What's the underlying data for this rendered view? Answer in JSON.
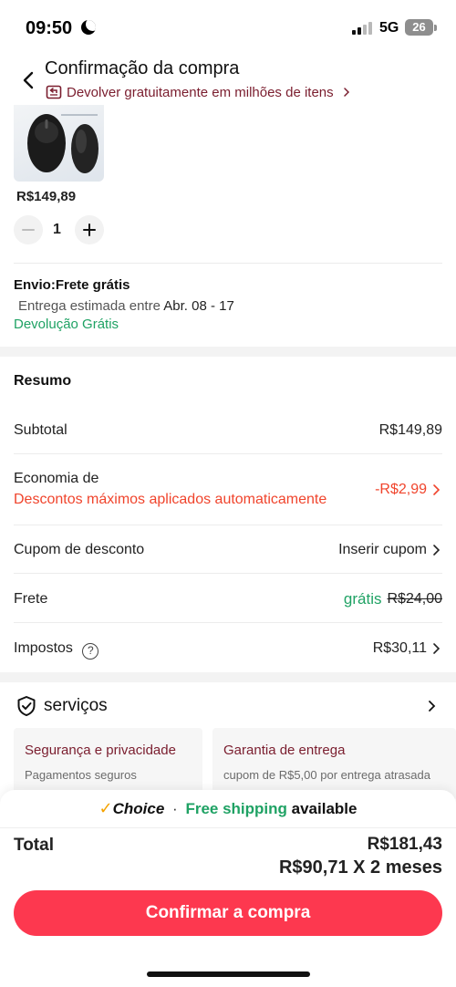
{
  "status_bar": {
    "time": "09:50",
    "network": "5G",
    "battery": "26"
  },
  "header": {
    "title": "Confirmação da compra",
    "return_banner": "Devolver gratuitamente em milhões de itens"
  },
  "product": {
    "price": "R$149,89",
    "quantity": "1"
  },
  "shipping": {
    "title": "Envio:Frete grátis",
    "delivery_prefix": "Entrega estimada entre",
    "delivery_dates": "Abr. 08 - 17",
    "free_return": "Devolução Grátis"
  },
  "summary": {
    "title": "Resumo",
    "subtotal_label": "Subtotal",
    "subtotal_value": "R$149,89",
    "savings_label": "Economia de",
    "savings_desc": "Descontos máximos aplicados automaticamente",
    "savings_value": "-R$2,99",
    "coupon_label": "Cupom de desconto",
    "coupon_value": "Inserir cupom",
    "shipping_label": "Frete",
    "shipping_free": "grátis",
    "shipping_old": "R$24,00",
    "taxes_label": "Impostos",
    "taxes_value": "R$30,11"
  },
  "services": {
    "title": "serviços",
    "cards": [
      {
        "title": "Segurança e privacidade",
        "subtitle": "Pagamentos seguros"
      },
      {
        "title": "Garantia de entrega",
        "subtitle": "cupom de R$5,00 por entrega atrasada"
      }
    ]
  },
  "footer": {
    "choice_mark": "✓",
    "choice_label": "Choice",
    "choice_sep": "·",
    "free_shipping": "Free shipping",
    "available": "available",
    "total_label": "Total",
    "total_value": "R$181,43",
    "installments": "R$90,71 X 2 meses",
    "confirm_button": "Confirmar a compra"
  },
  "colors": {
    "accent_red": "#fd384f",
    "discount_red": "#f0442c",
    "green": "#1fa264",
    "maroon": "#7a1d2e",
    "choice_gold": "#f5a300"
  },
  "icons": [
    "back-icon",
    "return-box-icon",
    "chevron-right-icon",
    "minus-icon",
    "plus-icon",
    "help-icon",
    "shield-check-icon",
    "moon-icon",
    "signal-icon",
    "battery-icon"
  ]
}
